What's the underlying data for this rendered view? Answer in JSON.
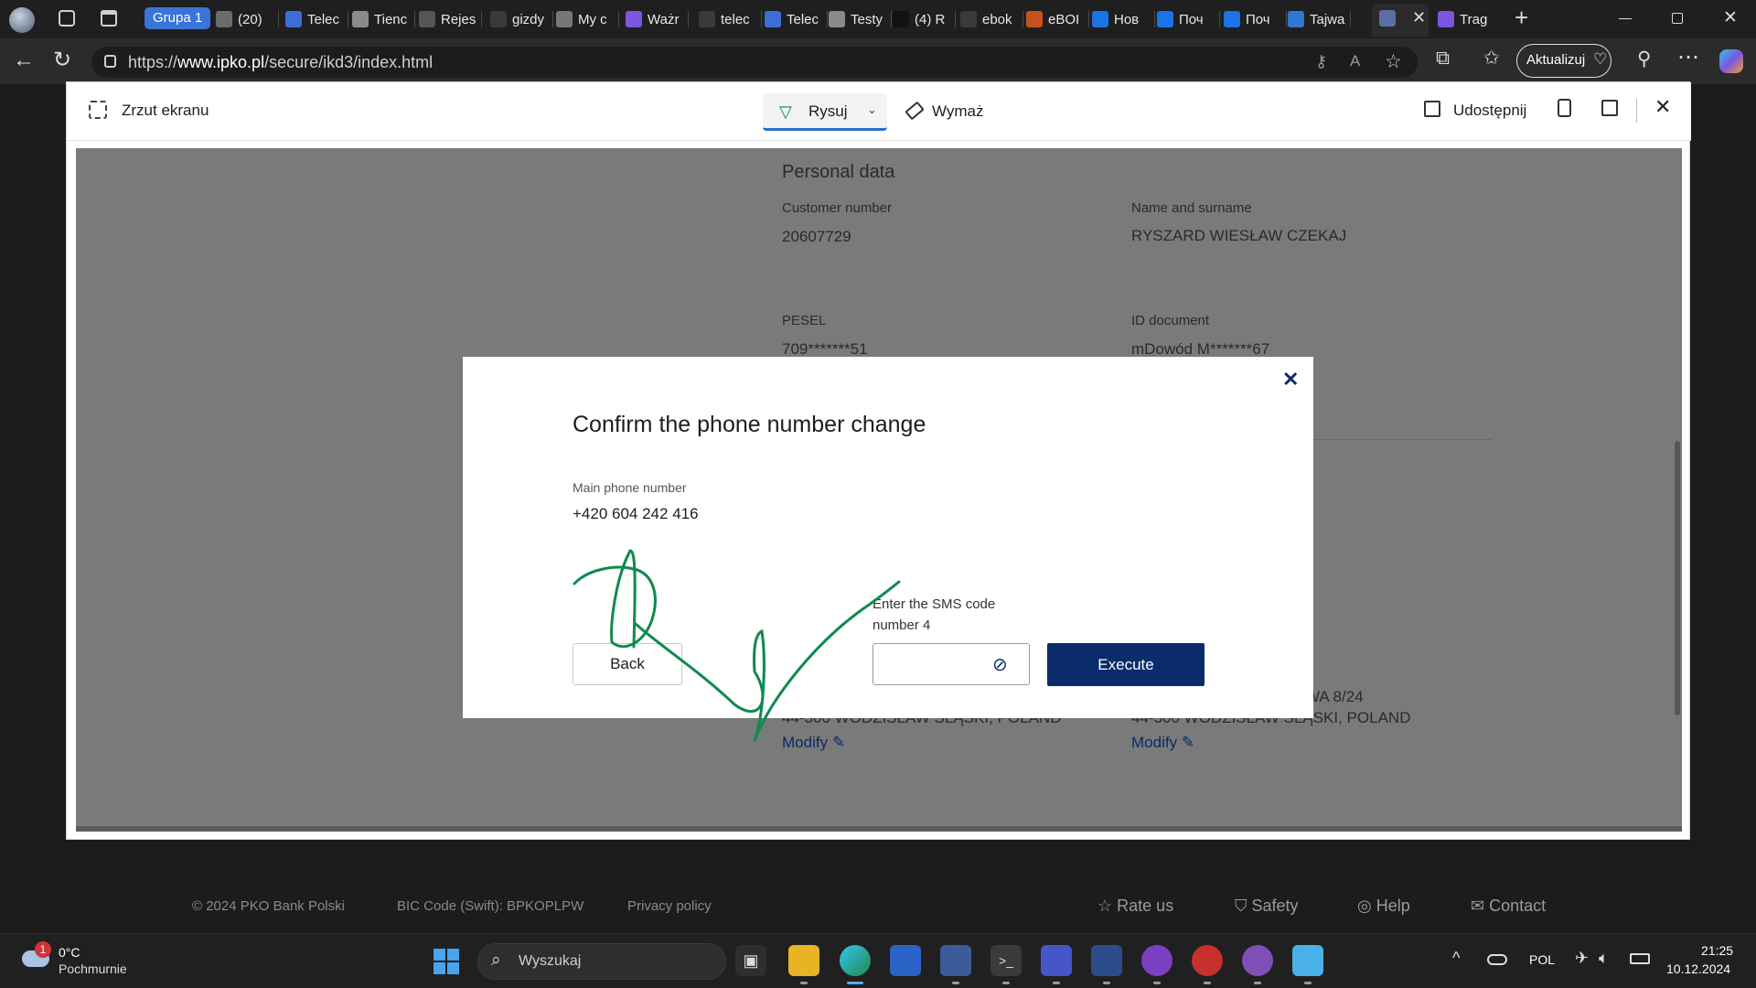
{
  "browser": {
    "tab_group": "Grupa 1",
    "tabs": [
      {
        "title": "(20)",
        "color": "#6b6b6b"
      },
      {
        "title": "Telec",
        "color": "#3b6fd6"
      },
      {
        "title": "Tienc",
        "color": "#8a8a8a"
      },
      {
        "title": "Rejes",
        "color": "#555555"
      },
      {
        "title": "gizdy",
        "color": "#3a3a3a"
      },
      {
        "title": "My c",
        "color": "#777777"
      },
      {
        "title": "Ważr",
        "color": "#7b56e0"
      },
      {
        "title": "telec",
        "color": "#3a3a3a"
      },
      {
        "title": "Telec",
        "color": "#3b6fd6"
      },
      {
        "title": "Testy",
        "color": "#8a8a8a"
      },
      {
        "title": "(4) R",
        "color": "#111111"
      },
      {
        "title": "ebok",
        "color": "#3a3a3a"
      },
      {
        "title": "eBOI",
        "color": "#c8501e"
      },
      {
        "title": "Нов",
        "color": "#1a73e8"
      },
      {
        "title": "Поч",
        "color": "#1a73e8"
      },
      {
        "title": "Поч",
        "color": "#1a73e8"
      },
      {
        "title": "Tajwa",
        "color": "#2f77d0"
      },
      {
        "title": "Trag",
        "color": "#7b56e0"
      }
    ],
    "url_prefix": "https://",
    "url_domain": "www.ipko.pl",
    "url_path": "/secure/ikd3/index.html",
    "update_button": "Aktualizuj",
    "new_tab": "+"
  },
  "snip": {
    "title": "Zrzut ekranu",
    "draw": "Rysuj",
    "erase": "Wymaż",
    "share": "Udostępnij"
  },
  "page": {
    "section_title": "Personal data",
    "customer_number_label": "Customer number",
    "customer_number": "20607729",
    "name_label": "Name and surname",
    "name": "RYSZARD WIESŁAW CZEKAJ",
    "pesel_label": "PESEL",
    "pesel": "709*******51",
    "id_label": "ID document",
    "id_value": "mDowód M*******67",
    "addr1_tail": "WA 8/24",
    "addr_city": "44-300 WODZISŁAW ŚLĄSKI, POLAND",
    "modify": "Modify"
  },
  "dialog": {
    "title": "Confirm the phone number change",
    "phone_label": "Main phone number",
    "phone": "+420 604 242 416",
    "sms_label_line1": "Enter the SMS code",
    "sms_label_line2": "number 4",
    "back": "Back",
    "execute": "Execute"
  },
  "footer": {
    "copyright": "© 2024 PKO Bank Polski",
    "bic": "BIC Code (Swift): BPKOPLPW",
    "privacy": "Privacy policy",
    "rate": "Rate us",
    "safety": "Safety",
    "help": "Help",
    "contact": "Contact"
  },
  "taskbar": {
    "weather_temp": "0°C",
    "weather_desc": "Pochmurnie",
    "weather_badge": "1",
    "search_placeholder": "Wyszukaj",
    "lang": "POL",
    "time": "21:25",
    "date": "10.12.2024"
  },
  "colors": {
    "pko_navy": "#0a2c6b",
    "ink_green": "#0f8a4f",
    "tab_group": "#3b74d8"
  }
}
